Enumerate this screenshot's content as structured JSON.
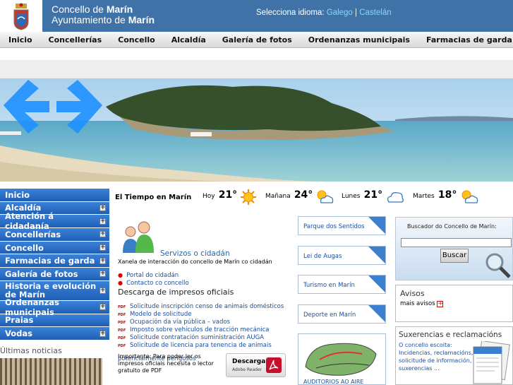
{
  "header": {
    "title_prefix": "Concello de ",
    "title_bold": "Marín",
    "subtitle_prefix": "Ayuntamiento de ",
    "subtitle_bold": "Marín",
    "language_label": "Selecciona idioma:",
    "lang_gl": "Galego",
    "lang_sep": "|",
    "lang_es": "Castelán"
  },
  "topnav": [
    "Inicio",
    "Concellerías",
    "Concello",
    "Alcaldía",
    "Galería de fotos",
    "Ordenanzas municipais",
    "Farmacias de garda"
  ],
  "leftmenu": [
    {
      "label": "Inicio",
      "has_plus": false
    },
    {
      "label": "Alcaldía",
      "has_plus": true
    },
    {
      "label": "Atención á cidadanía",
      "has_plus": true
    },
    {
      "label": "Concellerías",
      "has_plus": true
    },
    {
      "label": "Concello",
      "has_plus": true
    },
    {
      "label": "Farmacias de garda",
      "has_plus": true
    },
    {
      "label": "Galería de fotos",
      "has_plus": true
    },
    {
      "label": "Historia e evolución de Marín",
      "has_plus": true
    },
    {
      "label": "Ordenanzas municipais",
      "has_plus": true
    },
    {
      "label": "Praias",
      "has_plus": false
    },
    {
      "label": "Vodas",
      "has_plus": true
    }
  ],
  "noticias_label": "Últimas noticias",
  "weather": {
    "title": "El Tiempo en Marín",
    "days": [
      {
        "label": "Hoy",
        "temp": "21°",
        "icon": "sun-icon"
      },
      {
        "label": "Mañana",
        "temp": "24°",
        "icon": "sun-cloud-icon"
      },
      {
        "label": "Lunes",
        "temp": "21°",
        "icon": "cloud-icon"
      },
      {
        "label": "Martes",
        "temp": "18°",
        "icon": "sun-cloud-icon"
      }
    ]
  },
  "servizos": {
    "title": "Servizos o cidadán",
    "description": "Xanela de interacción do concello de Marín co cidadán",
    "links": [
      "Portal do cidadán",
      "Contacto co concello"
    ]
  },
  "descarga": {
    "title": "Descarga de impresos oficiais",
    "items": [
      "Solicitude inscripción censo de animais domésticos",
      "Modelo de solicitude",
      "Ocupación da vía pública – vados",
      "Imposto sobre vehículos de tracción mecánica",
      "Solicitude contratación suministración AUGA",
      "Solicitude de licencia para tenencia de animais potencialmente perigosos"
    ],
    "pdf_tag": "PDF",
    "importante": "Importante: Para poder ler os impresos oficiais necesita o lector gratuito de PDF",
    "reader_label": "Descarga",
    "reader_sub": "Adobe Reader"
  },
  "linkboxes": [
    "Parque dos Sentidos",
    "Lei de Augas",
    "Turismo en Marín",
    "Deporte en Marín"
  ],
  "auditorios_label": "AUDITORIOS AO AIRE",
  "buscador": {
    "title": "Buscador do Concello de Marín:",
    "input_value": "",
    "button_label": "Buscar"
  },
  "avisos": {
    "title": "Avisos",
    "more": "mais avisos"
  },
  "sugerencias": {
    "title": "Suxerencias e reclamacións",
    "text": "O concello escoita: Incidencias, reclamacións, solicitude de información, suxerencias ..."
  }
}
